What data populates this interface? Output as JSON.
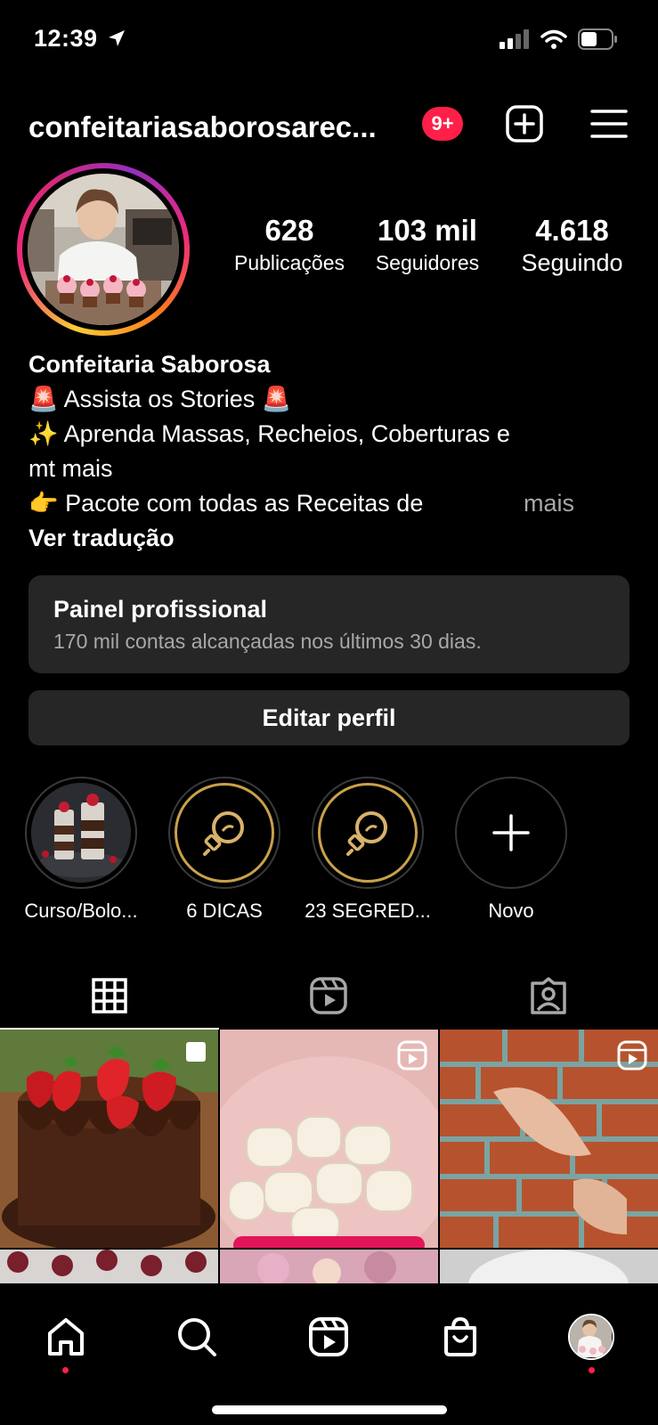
{
  "status_bar": {
    "time": "12:39"
  },
  "header": {
    "username": "confeitariasaborosarec...",
    "notification_badge": "9+"
  },
  "profile": {
    "stats": [
      {
        "value": "628",
        "label": "Publicações"
      },
      {
        "value": "103 mil",
        "label": "Seguidores"
      },
      {
        "value": "4.618",
        "label": "Seguindo"
      }
    ]
  },
  "bio": {
    "name": "Confeitaria Saborosa",
    "line1": "🚨 Assista os Stories 🚨",
    "line2": "✨ Aprenda Massas, Recheios, Coberturas e",
    "line3": "mt mais",
    "line4": "👉 Pacote com todas as Receitas de",
    "more": "mais",
    "translate": "Ver tradução"
  },
  "professional_panel": {
    "title": "Painel profissional",
    "subtitle": "170 mil contas alcançadas nos últimos 30 dias."
  },
  "edit_profile_label": "Editar perfil",
  "highlights": [
    {
      "label": "Curso/Bolo..."
    },
    {
      "label": "6 DICAS"
    },
    {
      "label": "23 SEGRED..."
    },
    {
      "label": "Novo"
    }
  ],
  "colors": {
    "background": "#000000",
    "card": "#262626",
    "accent_red": "#ff1f48",
    "muted_text": "#a8a8a8",
    "highlight_gold": "#c9a14a"
  },
  "icons": {
    "header": [
      "add-post-icon",
      "menu-icon"
    ],
    "tabs": [
      "grid-icon",
      "reels-icon",
      "tagged-icon"
    ],
    "nav": [
      "home-icon",
      "search-icon",
      "reels-icon",
      "shop-icon",
      "profile-avatar"
    ]
  }
}
